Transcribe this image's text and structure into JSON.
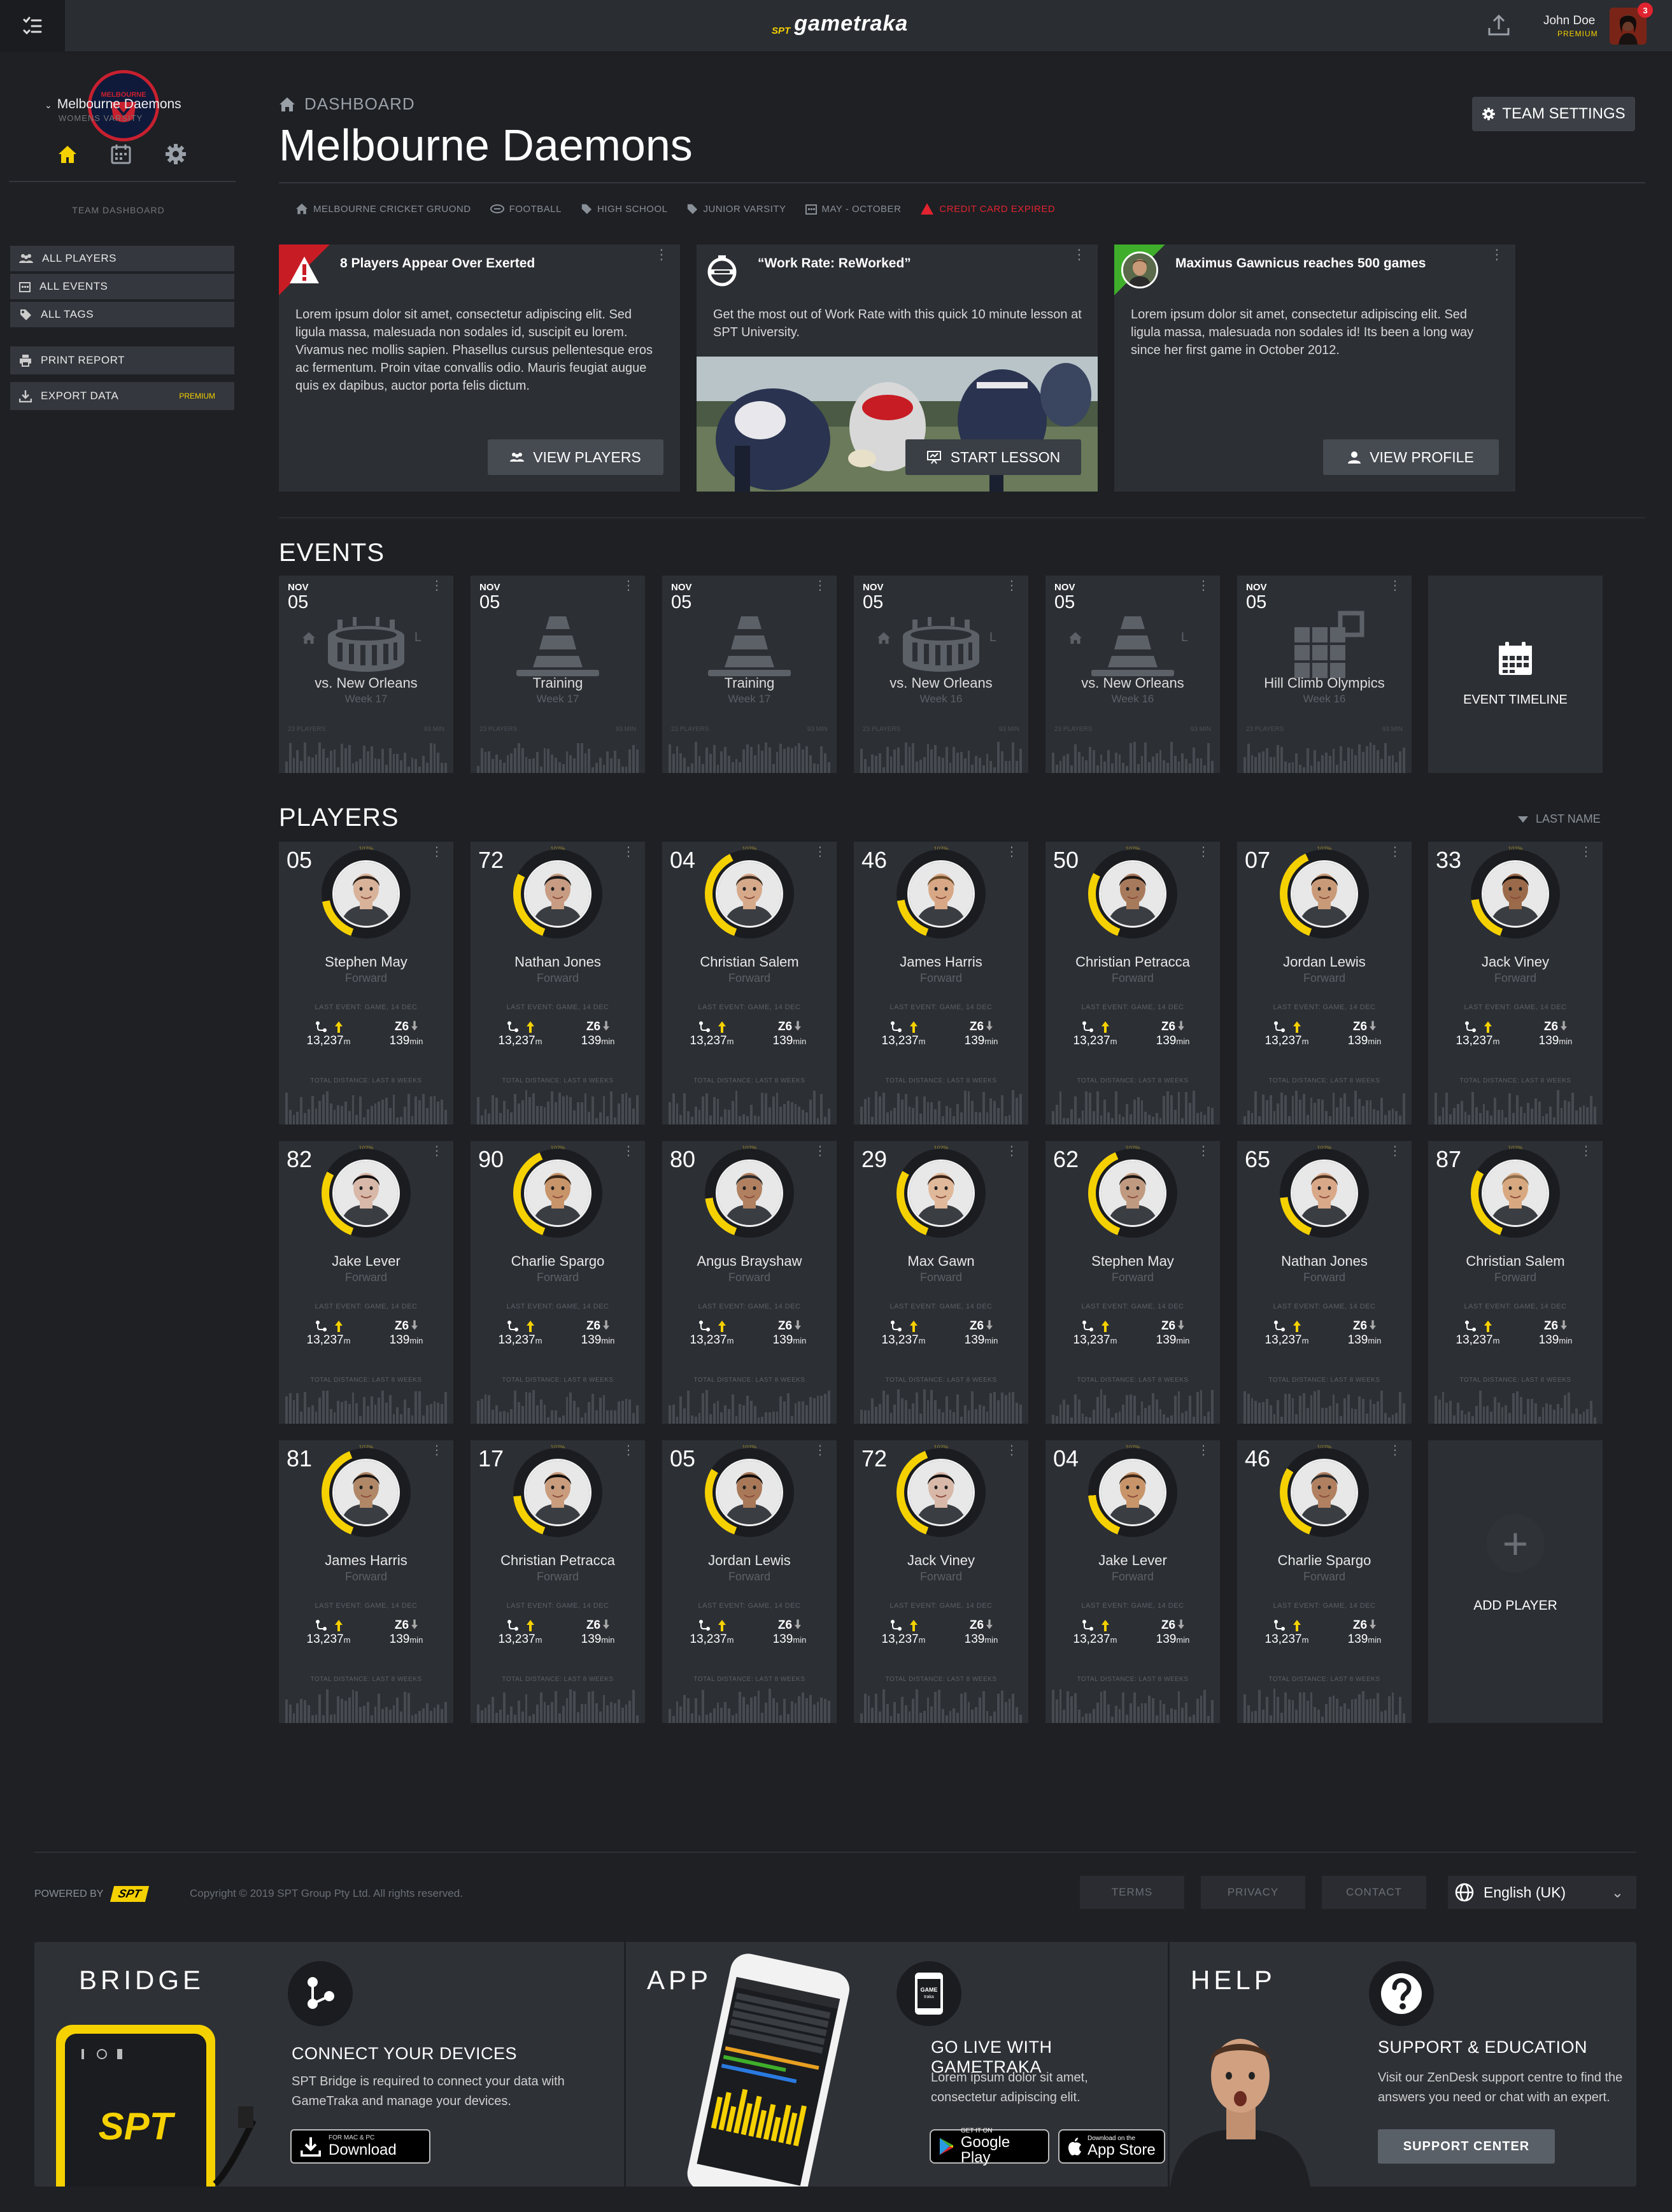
{
  "topbar": {
    "logo_small": "SPT",
    "logo_main": "gametraka",
    "user_name": "John Doe",
    "user_tier": "PREMIUM",
    "notifications": "3"
  },
  "sidebar": {
    "team_name": "Melbourne Daemons",
    "team_sub": "WOMENS VARSITY",
    "crest_text": "MELBOURNE",
    "section_label": "TEAM DASHBOARD",
    "items": [
      {
        "label": "ALL PLAYERS",
        "icon": "users-icon"
      },
      {
        "label": "ALL EVENTS",
        "icon": "calendar-icon"
      },
      {
        "label": "ALL TAGS",
        "icon": "tag-icon"
      }
    ],
    "actions": [
      {
        "label": "PRINT REPORT",
        "icon": "printer-icon"
      },
      {
        "label": "EXPORT DATA",
        "icon": "download-icon",
        "badge": "PREMIUM"
      }
    ]
  },
  "header": {
    "breadcrumb": "DASHBOARD",
    "title": "Melbourne Daemons",
    "settings_label": "TEAM SETTINGS",
    "meta": [
      {
        "label": "MELBOURNE CRICKET GRUOND",
        "icon": "home-icon"
      },
      {
        "label": "FOOTBALL",
        "icon": "ball-icon"
      },
      {
        "label": "HIGH SCHOOL",
        "icon": "tag-icon"
      },
      {
        "label": "JUNIOR VARSITY",
        "icon": "tag-icon"
      },
      {
        "label": "MAY - OCTOBER",
        "icon": "calendar-icon"
      },
      {
        "label": "CREDIT CARD EXPIRED",
        "icon": "warning-icon",
        "alert": true
      }
    ]
  },
  "cards": [
    {
      "title": "8 Players Appear Over Exerted",
      "body": "Lorem ipsum dolor sit amet, consectetur adipiscing elit. Sed ligula massa, malesuada non sodales id, suscipit eu lorem. Vivamus nec mollis sapien. Phasellus cursus pellentesque eros ac fermentum. Proin vitae convallis odio. Mauris feugiat augue quis ex dapibus, auctor porta felis dictum.",
      "button": "VIEW PLAYERS"
    },
    {
      "title": "“Work Rate: ReWorked”",
      "body": "Get the most out of Work Rate with this quick 10 minute lesson at SPT University.",
      "button": "START LESSON"
    },
    {
      "title": "Maximus Gawnicus reaches 500 games",
      "body": "Lorem ipsum dolor sit amet, consectetur adipiscing elit. Sed ligula massa, malesuada non sodales id! Its been a long way since her first game in October 2012.",
      "button": "VIEW PROFILE"
    }
  ],
  "events_title": "EVENTS",
  "events": [
    {
      "month": "NOV",
      "day": "05",
      "name": "vs. New Orleans",
      "week": "Week 17",
      "players": "23 PLAYERS",
      "mins": "93 MIN",
      "type": "stadium",
      "home": "home",
      "result": "L"
    },
    {
      "month": "NOV",
      "day": "05",
      "name": "Training",
      "week": "Week 17",
      "players": "23 PLAYERS",
      "mins": "93 MIN",
      "type": "cone"
    },
    {
      "month": "NOV",
      "day": "05",
      "name": "Training",
      "week": "Week 17",
      "players": "23 PLAYERS",
      "mins": "93 MIN",
      "type": "cone"
    },
    {
      "month": "NOV",
      "day": "05",
      "name": "vs. New Orleans",
      "week": "Week 16",
      "players": "23 PLAYERS",
      "mins": "93 MIN",
      "type": "stadium",
      "home": "home",
      "result": "L"
    },
    {
      "month": "NOV",
      "day": "05",
      "name": "vs. New Orleans",
      "week": "Week 16",
      "players": "23 PLAYERS",
      "mins": "93 MIN",
      "type": "cone",
      "home": "home",
      "result": "L"
    },
    {
      "month": "NOV",
      "day": "05",
      "name": "Hill Climb Olympics",
      "week": "Week 16",
      "players": "23 PLAYERS",
      "mins": "93 MIN",
      "type": "grid"
    }
  ],
  "event_timeline": "EVENT TIMELINE",
  "players_title": "PLAYERS",
  "sort_label": "LAST NAME",
  "player_common": {
    "last_event": "LAST EVENT: GAME, 14 DEC",
    "distance": "13,237",
    "distance_unit": "m",
    "zone": "Z6",
    "minutes": "139",
    "minutes_unit": "min",
    "total_label": "TOTAL DISTANCE: LAST 8 WEEKS",
    "pct": "102%"
  },
  "players": [
    {
      "num": "05",
      "name": "Stephen May",
      "pos": "Forward",
      "skin": "#d8b39a",
      "hair": "#2a1e16"
    },
    {
      "num": "72",
      "name": "Nathan Jones",
      "pos": "Forward",
      "skin": "#c89c82",
      "hair": "#1e1a18"
    },
    {
      "num": "04",
      "name": "Christian Salem",
      "pos": "Forward",
      "skin": "#d6a98a",
      "hair": "#3a2a1e"
    },
    {
      "num": "46",
      "name": "James Harris",
      "pos": "Forward",
      "skin": "#d8a886",
      "hair": "#6a4a2a"
    },
    {
      "num": "50",
      "name": "Christian Petracca",
      "pos": "Forward",
      "skin": "#a87a5c",
      "hair": "#1a1410"
    },
    {
      "num": "07",
      "name": "Jordan Lewis",
      "pos": "Forward",
      "skin": "#c89a78",
      "hair": "#140f0c"
    },
    {
      "num": "33",
      "name": "Jack Viney",
      "pos": "Forward",
      "skin": "#9a6a4a",
      "hair": "#120d0a"
    },
    {
      "num": "82",
      "name": "Jake Lever",
      "pos": "Forward",
      "skin": "#d8b8a8",
      "hair": "#120e0e"
    },
    {
      "num": "90",
      "name": "Charlie Spargo",
      "pos": "Forward",
      "skin": "#c8946a",
      "hair": "#3a2618"
    },
    {
      "num": "80",
      "name": "Angus Brayshaw",
      "pos": "Forward",
      "skin": "#b08060",
      "hair": "#2a2a2a"
    },
    {
      "num": "29",
      "name": "Max Gawn",
      "pos": "Forward",
      "skin": "#e0b89a",
      "hair": "#3a2418"
    },
    {
      "num": "62",
      "name": "Stephen May",
      "pos": "Forward",
      "skin": "#c09a80",
      "hair": "#1a1614"
    },
    {
      "num": "65",
      "name": "Nathan Jones",
      "pos": "Forward",
      "skin": "#d8a888",
      "hair": "#4a3020"
    },
    {
      "num": "87",
      "name": "Christian Salem",
      "pos": "Forward",
      "skin": "#d8a880",
      "hair": "#8a6a4a"
    },
    {
      "num": "81",
      "name": "James Harris",
      "pos": "Forward",
      "skin": "#b08868",
      "hair": "#1a1410"
    },
    {
      "num": "17",
      "name": "Christian Petracca",
      "pos": "Forward",
      "skin": "#c89c7c",
      "hair": "#140f0c"
    },
    {
      "num": "05",
      "name": "Jordan Lewis",
      "pos": "Forward",
      "skin": "#a87858",
      "hair": "#120d0a"
    },
    {
      "num": "72",
      "name": "Jack Viney",
      "pos": "Forward",
      "skin": "#d8b8a8",
      "hair": "#120e0e"
    },
    {
      "num": "04",
      "name": "Jake Lever",
      "pos": "Forward",
      "skin": "#c8946a",
      "hair": "#3a2618"
    },
    {
      "num": "46",
      "name": "Charlie Spargo",
      "pos": "Forward",
      "skin": "#b08060",
      "hair": "#2a2a2a"
    }
  ],
  "add_player": "ADD PLAYER",
  "footer": {
    "powered_by": "POWERED BY",
    "powered_logo": "SPT",
    "copyright": "Copyright © 2019 SPT Group Pty Ltd. All rights reserved.",
    "links": [
      "TERMS",
      "PRIVACY",
      "CONTACT"
    ],
    "language": "English (UK)"
  },
  "promo": {
    "bridge": {
      "head": "BRIDGE",
      "sub": "CONNECT YOUR DEVICES",
      "desc": "SPT Bridge is required to connect your data with GameTraka and manage your devices.",
      "btn_small": "FOR MAC & PC",
      "btn_main": "Download",
      "device_logo": "SPT"
    },
    "app": {
      "head": "APP",
      "sub": "GO LIVE WITH GAMETRAKA",
      "desc": "Lorem ipsum dolor sit amet, consectetur adipiscing elit.",
      "google_small": "GET IT ON",
      "google_main": "Google Play",
      "apple_small": "Download on the",
      "apple_main": "App Store"
    },
    "help": {
      "head": "HELP",
      "sub": "SUPPORT & EDUCATION",
      "desc": "Visit our ZenDesk support centre to find the answers you need or chat with an expert.",
      "btn": "SUPPORT CENTER"
    }
  },
  "colors": {
    "accent": "#f6d100",
    "alert": "#e0232f",
    "card": "#2c2f34",
    "bg": "#1e2024"
  }
}
